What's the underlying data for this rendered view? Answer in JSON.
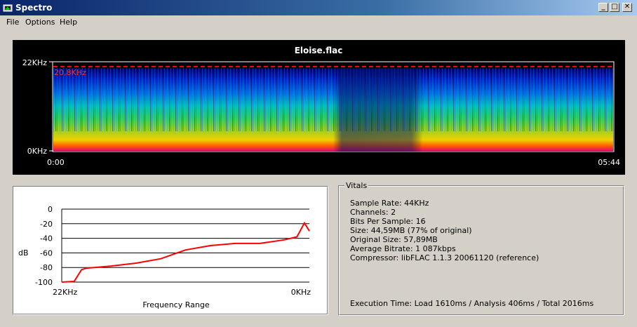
{
  "window": {
    "title": "Spectro",
    "minimize_glyph": "_",
    "restore_glyph": "□",
    "close_glyph": "✕"
  },
  "menu": [
    {
      "label": "File"
    },
    {
      "label": "Options"
    },
    {
      "label": "Help"
    }
  ],
  "spectrogram": {
    "title": "Eloise.flac",
    "freq_top_label": "22KHz",
    "freq_bottom_label": "0KHz",
    "cutoff_label": "20,8KHz",
    "cutoff_fraction": 0.945,
    "time_start_label": "0:00",
    "time_end_label": "05:44",
    "cutoff_color": "#ff0000"
  },
  "frequency_graph": {
    "chart_data": {
      "type": "line",
      "xlabel": "Frequency Range",
      "ylabel": "dB",
      "x_start_label": "22KHz",
      "x_end_label": "0KHz",
      "ylim": [
        -100,
        0
      ],
      "y_ticks": [
        "0",
        "-20",
        "-40",
        "-60",
        "-80",
        "-100"
      ],
      "y_tick_values": [
        0,
        -20,
        -40,
        -60,
        -80,
        -100
      ],
      "grid": true,
      "series": [
        {
          "color": "#ff0000",
          "x": [
            0,
            0.05,
            0.08,
            0.1,
            0.2,
            0.3,
            0.4,
            0.5,
            0.6,
            0.7,
            0.8,
            0.9,
            0.95,
            0.98,
            1.0
          ],
          "values": [
            -100,
            -99,
            -83,
            -81,
            -78,
            -74,
            -68,
            -56,
            -50,
            -47,
            -47,
            -42,
            -38,
            -19,
            -30
          ]
        }
      ]
    }
  },
  "vitals": {
    "title": "Vitals",
    "lines": [
      "Sample Rate: 44KHz",
      "Channels: 2",
      "Bits Per Sample: 16",
      "Size: 44,59MB (77% of original)",
      "Original Size: 57,89MB",
      "Average Bitrate: 1 087kbps",
      "Compressor: libFLAC 1.1.3 20061120 (reference)"
    ],
    "execution_time": "Execution Time: Load 1610ms / Analysis 406ms / Total 2016ms"
  }
}
